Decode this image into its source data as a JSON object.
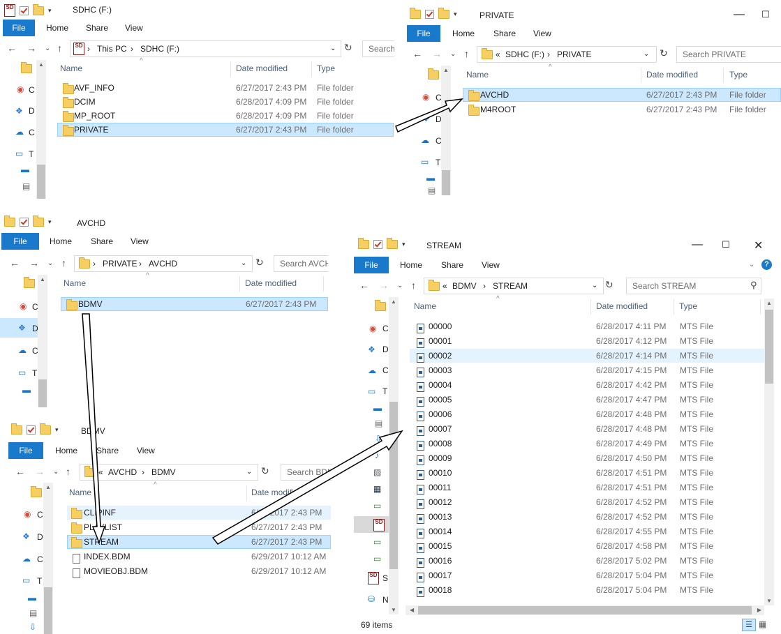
{
  "ribbon": {
    "file": "File",
    "home": "Home",
    "share": "Share",
    "view": "View"
  },
  "columns": {
    "name": "Name",
    "date": "Date modified",
    "type": "Type"
  },
  "nav_letters": [
    "C",
    "D",
    "C",
    "T"
  ],
  "sd_label": "SD",
  "win1": {
    "title": "SDHC (F:)",
    "crumbs": [
      "This PC",
      "SDHC (F:)"
    ],
    "search": "Search",
    "rows": [
      {
        "name": "AVF_INFO",
        "date": "6/27/2017 2:43 PM",
        "type": "File folder"
      },
      {
        "name": "DCIM",
        "date": "6/28/2017 4:09 PM",
        "type": "File folder"
      },
      {
        "name": "MP_ROOT",
        "date": "6/28/2017 4:09 PM",
        "type": "File folder"
      },
      {
        "name": "PRIVATE",
        "date": "6/27/2017 2:43 PM",
        "type": "File folder"
      }
    ]
  },
  "win2": {
    "title": "PRIVATE",
    "crumbs": [
      "SDHC (F:)",
      "PRIVATE"
    ],
    "search": "Search PRIVATE",
    "rows": [
      {
        "name": "AVCHD",
        "date": "6/27/2017 2:43 PM",
        "type": "File folder"
      },
      {
        "name": "M4ROOT",
        "date": "6/27/2017 2:43 PM",
        "type": "File folder"
      }
    ]
  },
  "win3": {
    "title": "AVCHD",
    "crumbs": [
      "PRIVATE",
      "AVCHD"
    ],
    "search": "Search AVCH",
    "rows": [
      {
        "name": "BDMV",
        "date": "6/27/2017 2:43 PM"
      }
    ]
  },
  "win4": {
    "title": "BDMV",
    "crumbs": [
      "AVCHD",
      "BDMV"
    ],
    "search": "Search BDM",
    "rows": [
      {
        "name": "CLIPINF",
        "date": "6/27/2017 2:43 PM",
        "kind": "folder"
      },
      {
        "name": "PLAYLIST",
        "date": "6/27/2017 2:43 PM",
        "kind": "folder"
      },
      {
        "name": "STREAM",
        "date": "6/27/2017 2:43 PM",
        "kind": "folder"
      },
      {
        "name": "INDEX.BDM",
        "date": "6/29/2017 10:12 AM",
        "kind": "file"
      },
      {
        "name": "MOVIEOBJ.BDM",
        "date": "6/29/2017 10:12 AM",
        "kind": "file"
      }
    ]
  },
  "win5": {
    "title": "STREAM",
    "crumbs": [
      "BDMV",
      "STREAM"
    ],
    "search": "Search STREAM",
    "status": "69 items",
    "rows": [
      {
        "name": "00000",
        "date": "6/28/2017 4:11 PM",
        "type": "MTS File"
      },
      {
        "name": "00001",
        "date": "6/28/2017 4:12 PM",
        "type": "MTS File"
      },
      {
        "name": "00002",
        "date": "6/28/2017 4:14 PM",
        "type": "MTS File"
      },
      {
        "name": "00003",
        "date": "6/28/2017 4:15 PM",
        "type": "MTS File"
      },
      {
        "name": "00004",
        "date": "6/28/2017 4:42 PM",
        "type": "MTS File"
      },
      {
        "name": "00005",
        "date": "6/28/2017 4:47 PM",
        "type": "MTS File"
      },
      {
        "name": "00006",
        "date": "6/28/2017 4:48 PM",
        "type": "MTS File"
      },
      {
        "name": "00007",
        "date": "6/28/2017 4:48 PM",
        "type": "MTS File"
      },
      {
        "name": "00008",
        "date": "6/28/2017 4:49 PM",
        "type": "MTS File"
      },
      {
        "name": "00009",
        "date": "6/28/2017 4:50 PM",
        "type": "MTS File"
      },
      {
        "name": "00010",
        "date": "6/28/2017 4:51 PM",
        "type": "MTS File"
      },
      {
        "name": "00011",
        "date": "6/28/2017 4:51 PM",
        "type": "MTS File"
      },
      {
        "name": "00012",
        "date": "6/28/2017 4:52 PM",
        "type": "MTS File"
      },
      {
        "name": "00013",
        "date": "6/28/2017 4:52 PM",
        "type": "MTS File"
      },
      {
        "name": "00014",
        "date": "6/28/2017 4:55 PM",
        "type": "MTS File"
      },
      {
        "name": "00015",
        "date": "6/28/2017 4:58 PM",
        "type": "MTS File"
      },
      {
        "name": "00016",
        "date": "6/28/2017 5:02 PM",
        "type": "MTS File"
      },
      {
        "name": "00017",
        "date": "6/28/2017 5:04 PM",
        "type": "MTS File"
      },
      {
        "name": "00018",
        "date": "6/28/2017 5:04 PM",
        "type": "MTS File"
      }
    ]
  }
}
